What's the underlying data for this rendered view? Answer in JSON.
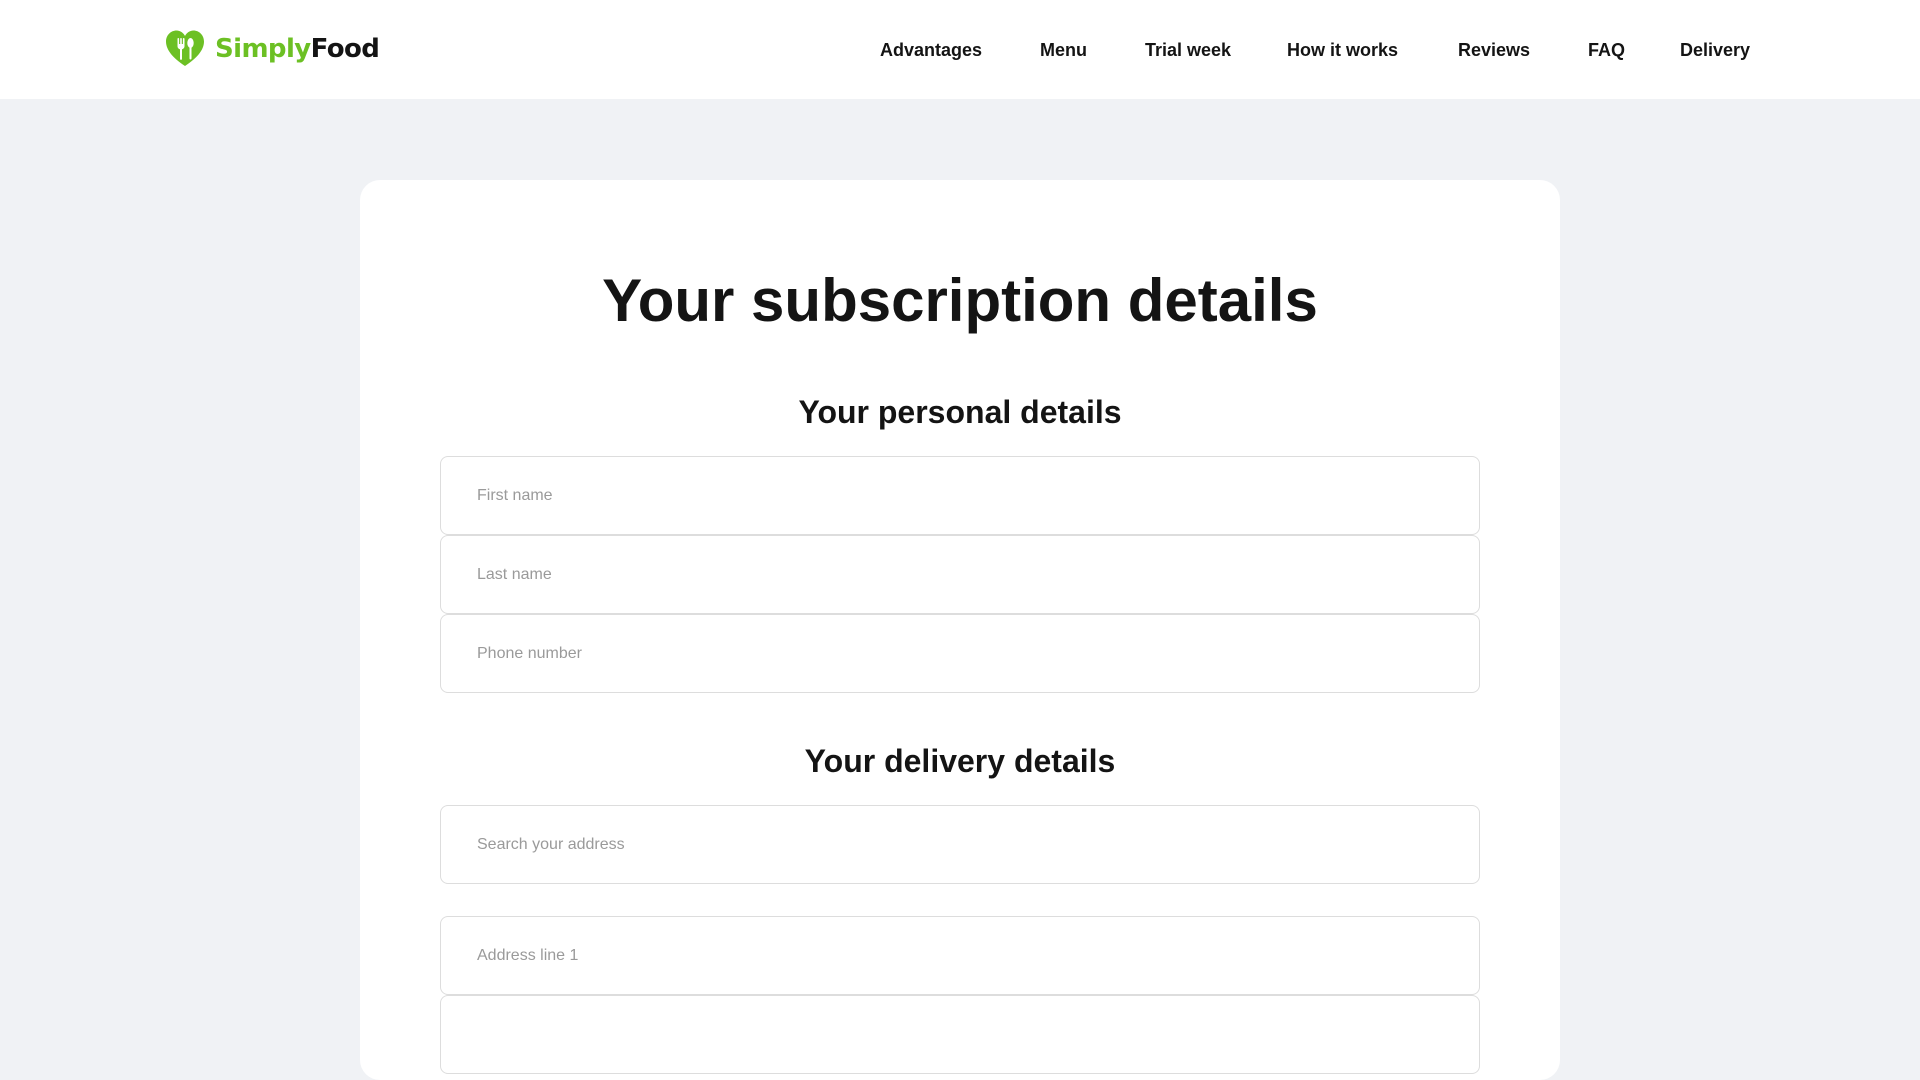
{
  "brand": {
    "name_part1": "Simply",
    "name_part2": "Food",
    "icon": "heart-fork-spoon-icon",
    "accent_color": "#6cc024"
  },
  "nav": {
    "items": [
      {
        "label": "Advantages"
      },
      {
        "label": "Menu"
      },
      {
        "label": "Trial week"
      },
      {
        "label": "How it works"
      },
      {
        "label": "Reviews"
      },
      {
        "label": "FAQ"
      },
      {
        "label": "Delivery"
      }
    ]
  },
  "main": {
    "title": "Your subscription details",
    "personal": {
      "heading": "Your personal details",
      "first_name_placeholder": "First name",
      "last_name_placeholder": "Last name",
      "phone_placeholder": "Phone number"
    },
    "delivery": {
      "heading": "Your delivery details",
      "search_placeholder": "Search your address",
      "address1_placeholder": "Address line 1",
      "address2_placeholder": ""
    }
  }
}
